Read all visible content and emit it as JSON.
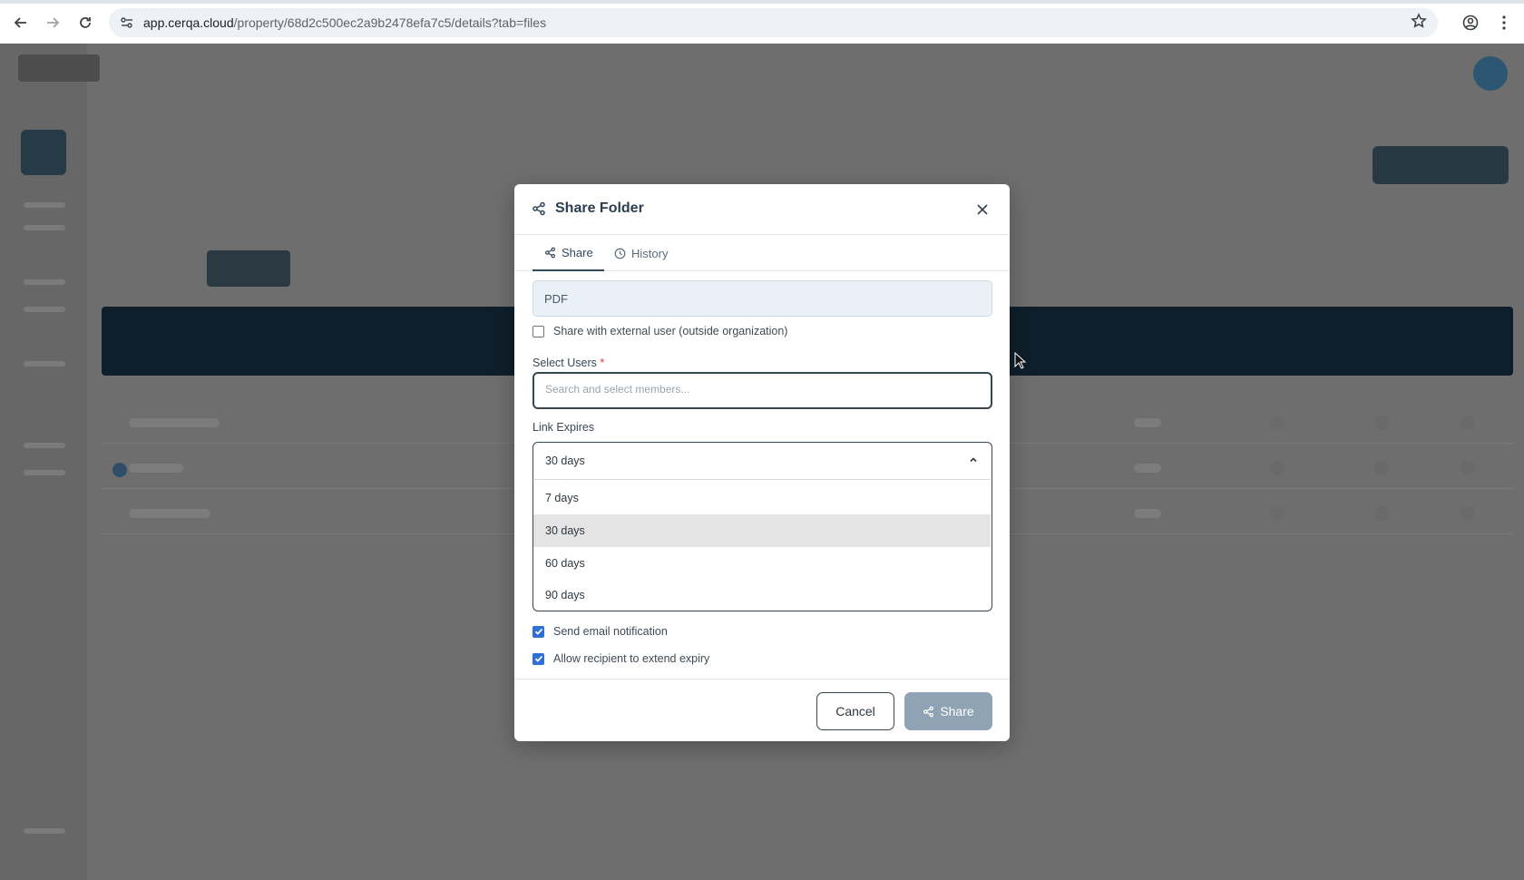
{
  "browser": {
    "url_host": "app.cerqa.cloud",
    "url_path": "/property/68d2c500ec2a9b2478efa7c5/details?tab=files",
    "icons": [
      "back-arrow-icon",
      "forward-arrow-icon",
      "reload-icon",
      "site-settings-icon",
      "bookmark-star-icon",
      "profile-icon",
      "more-vert-icon"
    ]
  },
  "modal": {
    "title": "Share Folder",
    "close_icon": "close-icon",
    "tabs": [
      {
        "label": "Share",
        "icon": "share-icon",
        "active": true
      },
      {
        "label": "History",
        "icon": "clock-icon",
        "active": false
      }
    ],
    "folder_name": "PDF",
    "external_user_label": "Share with external user (outside organization)",
    "external_user_checked": false,
    "select_users_label": "Select Users",
    "required_mark": "*",
    "select_users_placeholder": "Search and select members...",
    "link_expires_label": "Link Expires",
    "link_expires_value": "30 days",
    "link_expires_options": [
      "7 days",
      "30 days",
      "60 days",
      "90 days"
    ],
    "send_email_label": "Send email notification",
    "send_email_checked": true,
    "allow_extend_label": "Allow recipient to extend expiry",
    "allow_extend_checked": true,
    "cancel_label": "Cancel",
    "share_label": "Share"
  },
  "colors": {
    "overlay": "#6b6b6b",
    "primary_dark": "#37474f",
    "share_button_disabled": "#8fa3b4",
    "checkbox_accent": "#2f6fd6",
    "folder_field_bg": "#e9f0f7"
  }
}
